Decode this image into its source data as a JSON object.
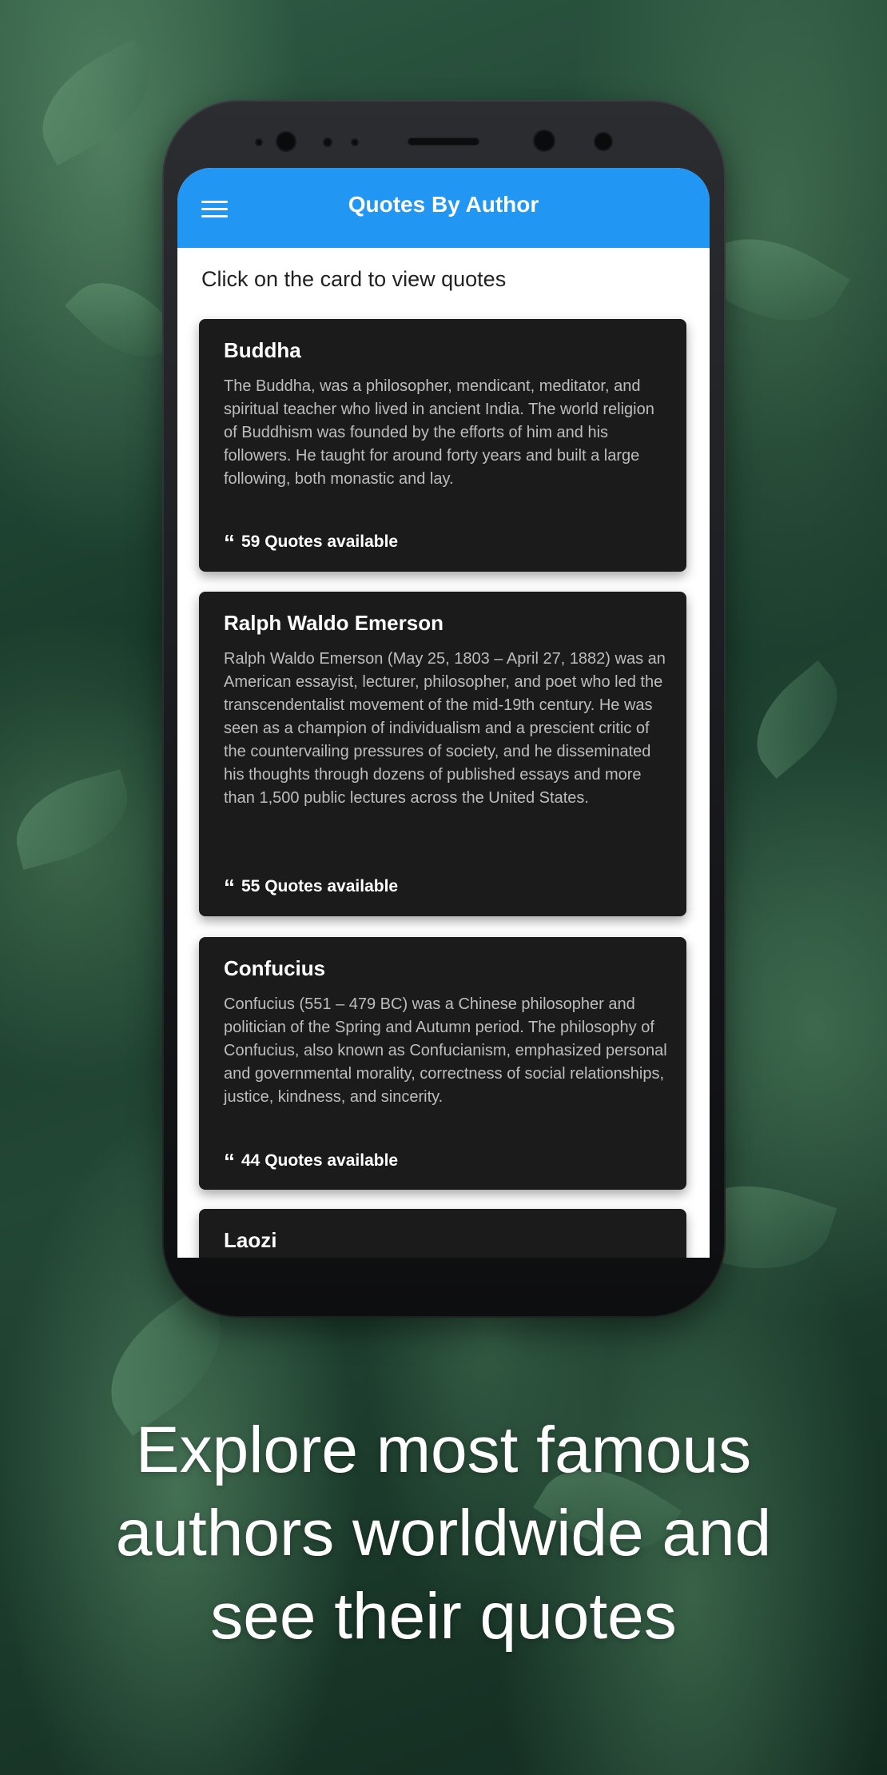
{
  "app": {
    "title": "Quotes By Author",
    "menu_icon": "hamburger-menu-icon",
    "bar_color": "#2196f3"
  },
  "main": {
    "hint": "Click on the card to view quotes",
    "cards": [
      {
        "name": "Buddha",
        "description": "The Buddha, was a philosopher, mendicant, meditator, and spiritual teacher who lived in ancient India. The world religion of Buddhism was founded by the efforts of him and his followers. He taught for around forty years and built a large following, both monastic and lay.",
        "quotes_available": "59 Quotes available"
      },
      {
        "name": "Ralph Waldo Emerson",
        "description": "Ralph Waldo Emerson (May 25, 1803 – April 27, 1882) was an American essayist, lecturer, philosopher, and poet who led the transcendentalist movement of the mid-19th century. He was seen as a champion of individualism and a prescient critic of the countervailing pressures of society, and he disseminated his thoughts through dozens of published essays and more than 1,500 public lectures across the United States.",
        "quotes_available": "55 Quotes available"
      },
      {
        "name": "Confucius",
        "description": "Confucius (551 – 479 BC) was a Chinese philosopher and politician of the Spring and Autumn period. The philosophy of Confucius, also known as Confucianism, emphasized personal and governmental morality, correctness of social relationships, justice, kindness, and sincerity.",
        "quotes_available": "44 Quotes available"
      },
      {
        "name": "Laozi"
      }
    ]
  },
  "footer": {
    "line1": "Explore most famous",
    "line2": "authors worldwide and",
    "line3": "see their quotes"
  },
  "colors": {
    "card_background": "#1b1b1b",
    "description_text": "#bdbdbd",
    "foreground_text": "#ffffff"
  }
}
